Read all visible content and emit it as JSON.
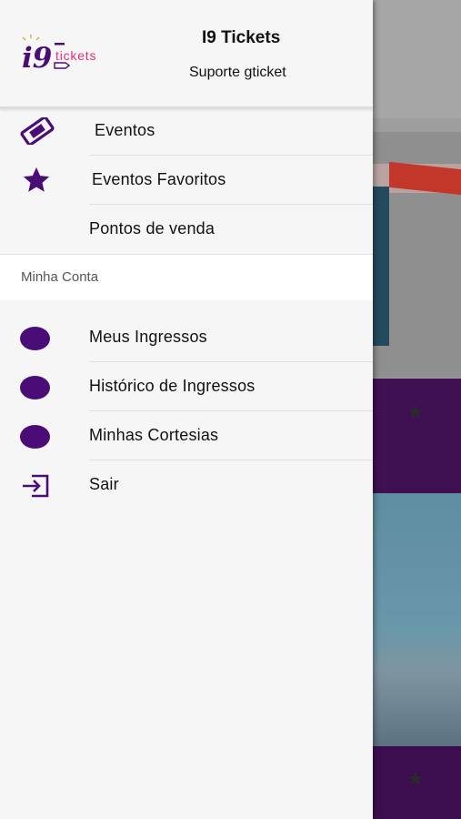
{
  "header": {
    "logo_text": "i9tickets",
    "title": "I9 Tickets",
    "subtitle": "Suporte gticket"
  },
  "menu": {
    "items": [
      {
        "label": "Eventos",
        "icon": "ticket-icon"
      },
      {
        "label": "Eventos Favoritos",
        "icon": "star-icon"
      },
      {
        "label": "Pontos de venda",
        "icon": ""
      }
    ]
  },
  "account": {
    "section_label": "Minha Conta",
    "items": [
      {
        "label": "Meus Ingressos",
        "icon": "dot-icon"
      },
      {
        "label": "Histórico de Ingressos",
        "icon": "dot-icon"
      },
      {
        "label": "Minhas Cortesias",
        "icon": "dot-icon"
      },
      {
        "label": "Sair",
        "icon": "logout-icon"
      }
    ]
  },
  "colors": {
    "brand_purple": "#4a0d77",
    "accent_pink": "#e0307a",
    "drawer_bg": "#f6f6f6"
  }
}
